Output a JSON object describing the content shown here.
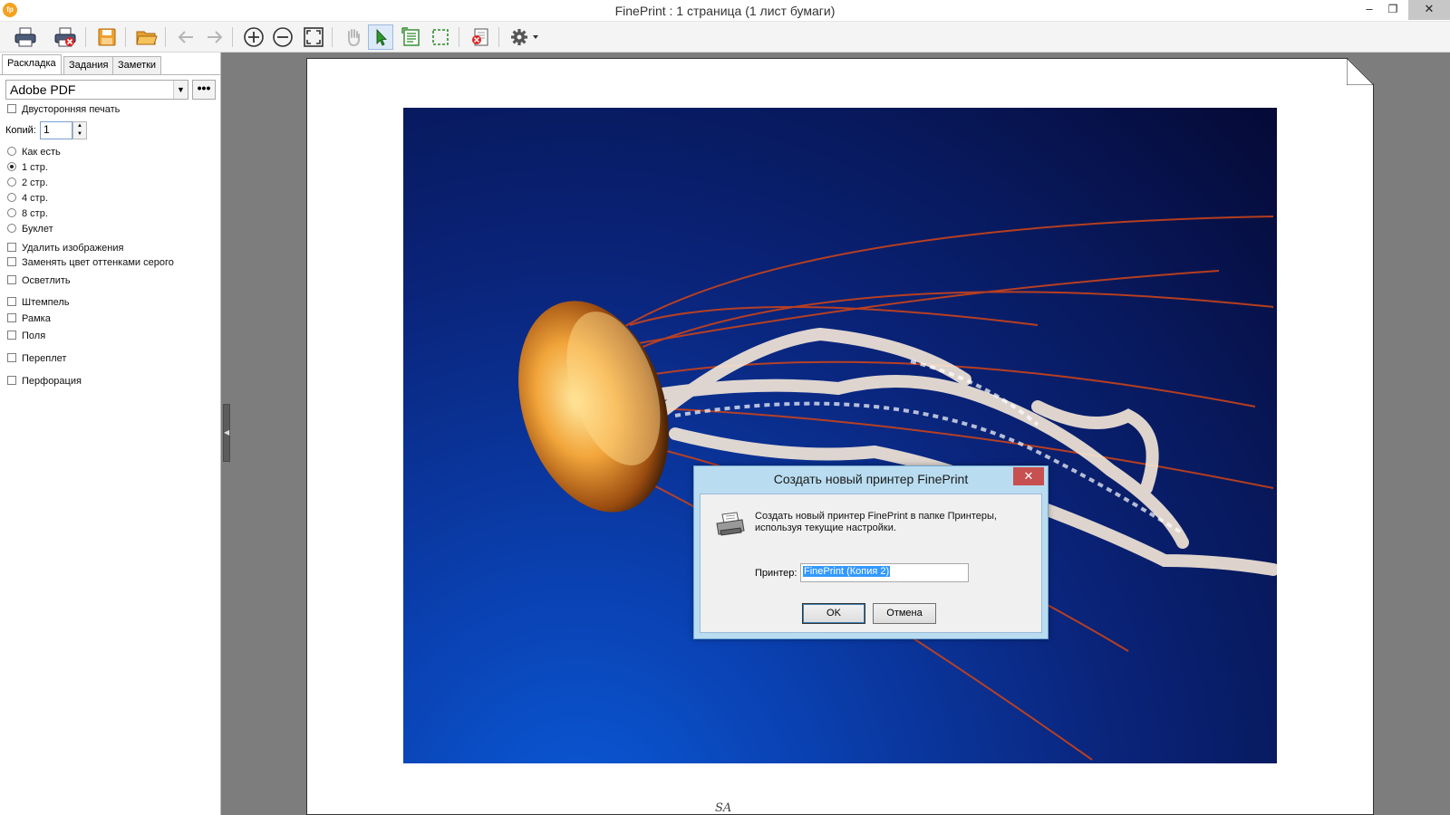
{
  "window": {
    "app_icon_text": "fp",
    "title": "FinePrint : 1 страница (1 лист бумаги)",
    "minimize_glyph": "–",
    "maximize_glyph": "❐",
    "close_glyph": "✕"
  },
  "toolbar": {
    "buttons": [
      {
        "name": "print-icon"
      },
      {
        "name": "print-and-close-icon"
      },
      {
        "name": "save-icon"
      },
      {
        "name": "open-folder-icon"
      },
      {
        "name": "back-arrow-icon"
      },
      {
        "name": "forward-arrow-icon"
      },
      {
        "name": "zoom-in-icon"
      },
      {
        "name": "zoom-out-icon"
      },
      {
        "name": "fit-page-icon"
      },
      {
        "name": "hand-tool-icon"
      },
      {
        "name": "select-arrow-icon"
      },
      {
        "name": "select-text-icon"
      },
      {
        "name": "select-region-icon"
      },
      {
        "name": "delete-page-icon"
      },
      {
        "name": "settings-gear-icon"
      }
    ]
  },
  "left_panel": {
    "tabs": [
      "Раскладка",
      "Задания",
      "Заметки"
    ],
    "printer": "Adobe PDF",
    "more_button": "•••",
    "duplex_label": "Двусторонняя печать",
    "copies_label": "Копий:",
    "copies_value": "1",
    "layout_options": [
      {
        "label": "Как есть",
        "selected": false
      },
      {
        "label": "1 стр.",
        "selected": true
      },
      {
        "label": "2 стр.",
        "selected": false
      },
      {
        "label": "4 стр.",
        "selected": false
      },
      {
        "label": "8 стр.",
        "selected": false
      },
      {
        "label": "Буклет",
        "selected": false
      }
    ],
    "checkboxes": [
      "Удалить изображения",
      "Заменять цвет оттенками серого",
      "Осветлить",
      "Штемпель",
      "Рамка",
      "Поля",
      "Переплет",
      "Перфорация"
    ]
  },
  "preview": {
    "footer_mark": "SA"
  },
  "dialog": {
    "title": "Создать новый принтер FinePrint",
    "close_glyph": "✕",
    "message_line1": "Создать новый принтер FinePrint в папке Принтеры,",
    "message_line2": "используя текущие настройки.",
    "printer_label": "Принтер:",
    "printer_value": "FinePrint (Копия 2)",
    "ok_label": "OK",
    "cancel_label": "Отмена"
  },
  "colors": {
    "dialog_frame": "#b9dcf0",
    "dialog_close": "#c75050",
    "selection": "#3399ff",
    "workspace": "#7d7d7d"
  }
}
